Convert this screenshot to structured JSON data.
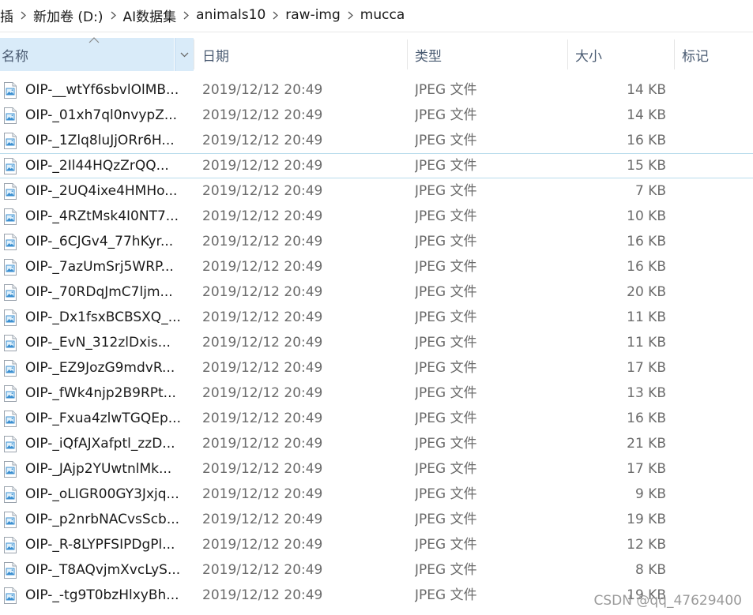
{
  "address_bar": {
    "crumbs": [
      "插",
      "新加卷 (D:)",
      "AI数据集",
      "animals10",
      "raw-img",
      "mucca"
    ]
  },
  "columns": {
    "name": "名称",
    "date": "日期",
    "type": "类型",
    "size": "大小",
    "tags": "标记",
    "sorted_column": "name",
    "sort_direction": "ascending"
  },
  "files": [
    {
      "name": "OIP-__wtYf6sbvlOlMB...",
      "date": "2019/12/12 20:49",
      "type": "JPEG 文件",
      "size": "14 KB"
    },
    {
      "name": "OIP-_01xh7ql0nvypZ...",
      "date": "2019/12/12 20:49",
      "type": "JPEG 文件",
      "size": "14 KB"
    },
    {
      "name": "OIP-_1Zlq8luJjORr6H...",
      "date": "2019/12/12 20:49",
      "type": "JPEG 文件",
      "size": "16 KB"
    },
    {
      "name": "OIP-_2Il44HQzZrQQ...",
      "date": "2019/12/12 20:49",
      "type": "JPEG 文件",
      "size": "15 KB"
    },
    {
      "name": "OIP-_2UQ4ixe4HMHo...",
      "date": "2019/12/12 20:49",
      "type": "JPEG 文件",
      "size": "7 KB"
    },
    {
      "name": "OIP-_4RZtMsk4I0NT7...",
      "date": "2019/12/12 20:49",
      "type": "JPEG 文件",
      "size": "10 KB"
    },
    {
      "name": "OIP-_6CJGv4_77hKyr...",
      "date": "2019/12/12 20:49",
      "type": "JPEG 文件",
      "size": "16 KB"
    },
    {
      "name": "OIP-_7azUmSrj5WRP...",
      "date": "2019/12/12 20:49",
      "type": "JPEG 文件",
      "size": "16 KB"
    },
    {
      "name": "OIP-_70RDqJmC7ljm...",
      "date": "2019/12/12 20:49",
      "type": "JPEG 文件",
      "size": "20 KB"
    },
    {
      "name": "OIP-_Dx1fsxBCBSXQ_...",
      "date": "2019/12/12 20:49",
      "type": "JPEG 文件",
      "size": "11 KB"
    },
    {
      "name": "OIP-_EvN_312zlDxis...",
      "date": "2019/12/12 20:49",
      "type": "JPEG 文件",
      "size": "11 KB"
    },
    {
      "name": "OIP-_EZ9JozG9mdvR...",
      "date": "2019/12/12 20:49",
      "type": "JPEG 文件",
      "size": "17 KB"
    },
    {
      "name": "OIP-_fWk4njp2B9RPt...",
      "date": "2019/12/12 20:49",
      "type": "JPEG 文件",
      "size": "13 KB"
    },
    {
      "name": "OIP-_Fxua4zlwTGQEp...",
      "date": "2019/12/12 20:49",
      "type": "JPEG 文件",
      "size": "16 KB"
    },
    {
      "name": "OIP-_iQfAJXafptl_zzD...",
      "date": "2019/12/12 20:49",
      "type": "JPEG 文件",
      "size": "21 KB"
    },
    {
      "name": "OIP-_JAjp2YUwtnlMk...",
      "date": "2019/12/12 20:49",
      "type": "JPEG 文件",
      "size": "17 KB"
    },
    {
      "name": "OIP-_oLIGR00GY3Jxjq...",
      "date": "2019/12/12 20:49",
      "type": "JPEG 文件",
      "size": "9 KB"
    },
    {
      "name": "OIP-_p2nrbNACvsScb...",
      "date": "2019/12/12 20:49",
      "type": "JPEG 文件",
      "size": "19 KB"
    },
    {
      "name": "OIP-_R-8LYPFSIPDgPl...",
      "date": "2019/12/12 20:49",
      "type": "JPEG 文件",
      "size": "12 KB"
    },
    {
      "name": "OIP-_T8AQvjmXvcLyS...",
      "date": "2019/12/12 20:49",
      "type": "JPEG 文件",
      "size": "8 KB"
    },
    {
      "name": "OIP-_-tg9T0bzHlxyBh...",
      "date": "2019/12/12 20:49",
      "type": "JPEG 文件",
      "size": "19 KB"
    }
  ],
  "hovered_row_index": 3,
  "icons": {
    "file": "jpeg-file-icon",
    "separator": "chevron-right-icon",
    "sort": "sort-ascending-icon",
    "column_menu": "chevron-down-icon"
  },
  "colors": {
    "sorted_header_bg": "#d9ebf9",
    "hover_border": "#b8dcec",
    "header_text": "#4a5b72"
  },
  "watermark": "CSDN @qq_47629400"
}
